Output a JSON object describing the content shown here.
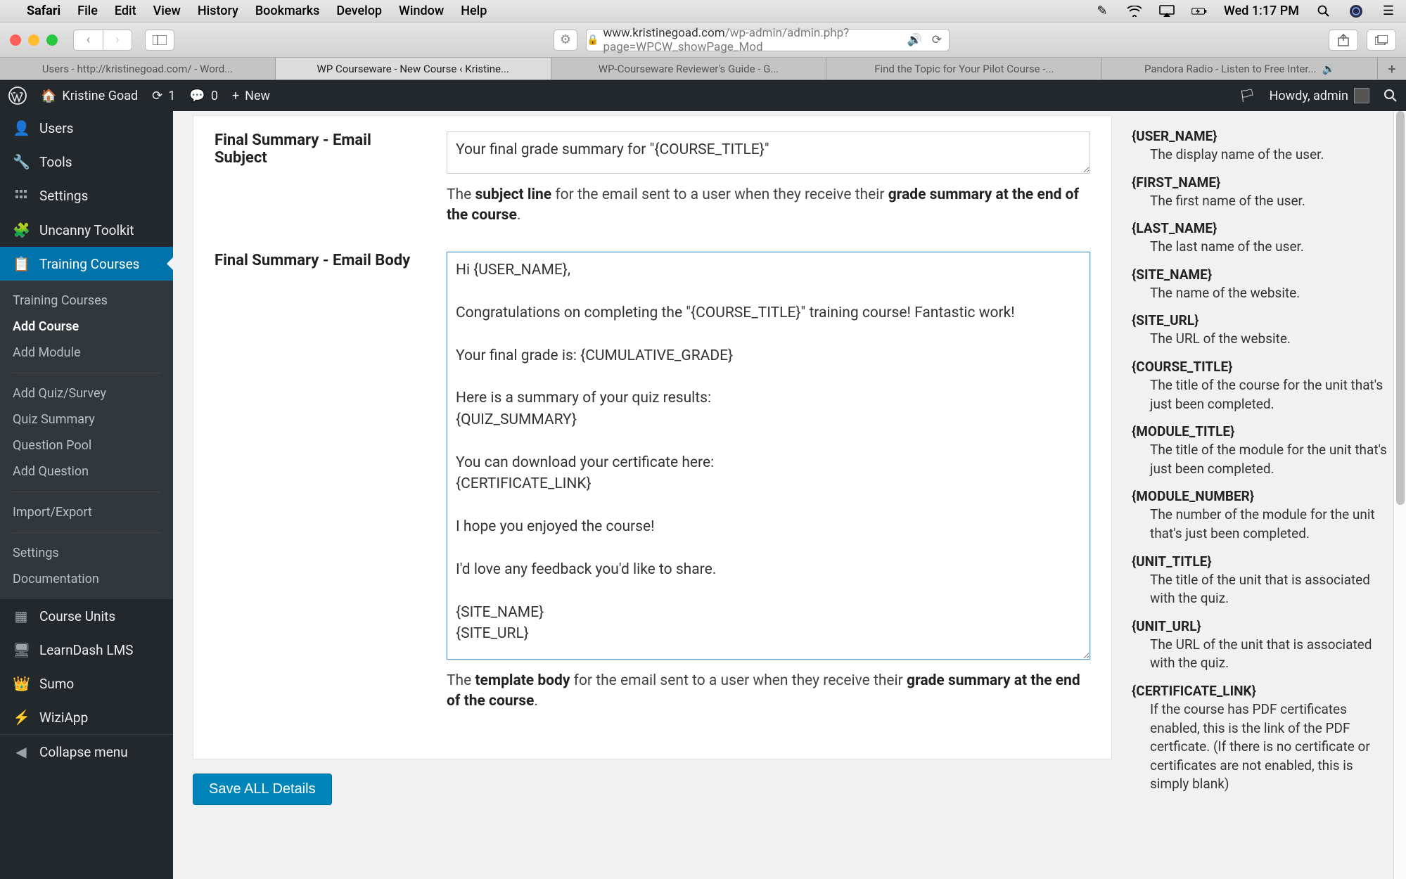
{
  "mac_menu": {
    "app": "Safari",
    "items": [
      "File",
      "Edit",
      "View",
      "History",
      "Bookmarks",
      "Develop",
      "Window",
      "Help"
    ],
    "clock": "Wed 1:17 PM"
  },
  "safari": {
    "url_visible": "www.kristinegoad.com/wp-admin/admin.php?page=WPCW_showPage_Mod",
    "tabs": [
      {
        "label": "Users - http://kristinegoad.com/ - Word...",
        "active": false
      },
      {
        "label": "WP Courseware - New Course ‹ Kristine...",
        "active": true
      },
      {
        "label": "WP-Courseware Reviewer's Guide - G...",
        "active": false
      },
      {
        "label": "Find the Topic for Your Pilot Course -...",
        "active": false
      },
      {
        "label": "Pandora Radio - Listen to Free Inter...",
        "active": false,
        "audio": true
      }
    ]
  },
  "wp_adminbar": {
    "site": "Kristine Goad",
    "updates": "1",
    "comments": "0",
    "new": "New",
    "howdy": "Howdy, admin"
  },
  "wp_sidebar": {
    "items": [
      {
        "icon": "👤",
        "label": "Users"
      },
      {
        "icon": "🔧",
        "label": "Tools"
      },
      {
        "icon": "⚙",
        "label": "Settings"
      },
      {
        "icon": "🧩",
        "label": "Uncanny Toolkit"
      },
      {
        "icon": "🎓",
        "label": "Training Courses",
        "current": true
      }
    ],
    "submenu": {
      "group1": [
        {
          "label": "Training Courses"
        },
        {
          "label": "Add Course",
          "current": true
        },
        {
          "label": "Add Module"
        }
      ],
      "group2": [
        {
          "label": "Add Quiz/Survey"
        },
        {
          "label": "Quiz Summary"
        },
        {
          "label": "Question Pool"
        },
        {
          "label": "Add Question"
        }
      ],
      "group3": [
        {
          "label": "Import/Export"
        }
      ],
      "group4": [
        {
          "label": "Settings"
        },
        {
          "label": "Documentation"
        }
      ]
    },
    "items_after": [
      {
        "icon": "▦",
        "label": "Course Units"
      },
      {
        "icon": "🖥",
        "label": "LearnDash LMS"
      },
      {
        "icon": "👑",
        "label": "Sumo"
      },
      {
        "icon": "⚡",
        "label": "WiziApp"
      }
    ],
    "collapse": "Collapse menu"
  },
  "form": {
    "subject_label": "Final Summary - Email Subject",
    "subject_value": "Your final grade summary for \"{COURSE_TITLE}\"",
    "subject_help_prefix": "The ",
    "subject_help_bold1": "subject line",
    "subject_help_mid": " for the email sent to a user when they receive their ",
    "subject_help_bold2": "grade summary at the end of the course",
    "subject_help_suffix": ".",
    "body_label": "Final Summary - Email Body",
    "body_value": "Hi {USER_NAME},\n\nCongratulations on completing the \"{COURSE_TITLE}\" training course! Fantastic work!\n\nYour final grade is: {CUMULATIVE_GRADE}\n\nHere is a summary of your quiz results:\n{QUIZ_SUMMARY}\n\nYou can download your certificate here:\n{CERTIFICATE_LINK}\n\nI hope you enjoyed the course!\n\nI'd love any feedback you'd like to share.\n\n{SITE_NAME}\n{SITE_URL}",
    "body_help_prefix": "The ",
    "body_help_bold1": "template body",
    "body_help_mid": " for the email sent to a user when they receive their ",
    "body_help_bold2": "grade summary at the end of the course",
    "body_help_suffix": ".",
    "save_button": "Save ALL Details"
  },
  "token_help": [
    {
      "token": "{USER_NAME}",
      "desc": "The display name of the user."
    },
    {
      "token": "{FIRST_NAME}",
      "desc": "The first name of the user."
    },
    {
      "token": "{LAST_NAME}",
      "desc": "The last name of the user."
    },
    {
      "token": "{SITE_NAME}",
      "desc": "The name of the website."
    },
    {
      "token": "{SITE_URL}",
      "desc": "The URL of the website."
    },
    {
      "token": "{COURSE_TITLE}",
      "desc": "The title of the course for the unit that's just been completed."
    },
    {
      "token": "{MODULE_TITLE}",
      "desc": "The title of the module for the unit that's just been completed."
    },
    {
      "token": "{MODULE_NUMBER}",
      "desc": "The number of the module for the unit that's just been completed."
    },
    {
      "token": "{UNIT_TITLE}",
      "desc": "The title of the unit that is associated with the quiz."
    },
    {
      "token": "{UNIT_URL}",
      "desc": "The URL of the unit that is associated with the quiz."
    },
    {
      "token": "{CERTIFICATE_LINK}",
      "desc": "If the course has PDF certificates enabled, this is the link of the PDF certficate. (If there is no certificate or certificates are not enabled, this is simply blank)"
    }
  ]
}
